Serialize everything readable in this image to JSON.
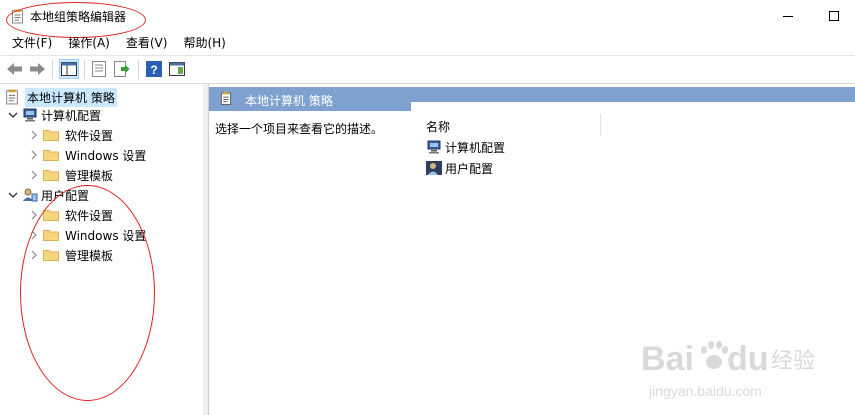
{
  "window": {
    "title": "本地组策略编辑器"
  },
  "menu": [
    {
      "label": "文件(F)"
    },
    {
      "label": "操作(A)"
    },
    {
      "label": "查看(V)"
    },
    {
      "label": "帮助(H)"
    }
  ],
  "toolbar": {
    "buttons": [
      "back-icon",
      "forward-icon",
      "show-hide-tree-icon",
      "properties-icon",
      "export-list-icon",
      "help-icon",
      "show-action-pane-icon"
    ]
  },
  "tree": {
    "root": "本地计算机 策略",
    "computer": {
      "label": "计算机配置",
      "children": [
        "软件设置",
        "Windows 设置",
        "管理模板"
      ]
    },
    "user": {
      "label": "用户配置",
      "children": [
        "软件设置",
        "Windows 设置",
        "管理模板"
      ]
    }
  },
  "right": {
    "header": "本地计算机 策略",
    "description": "选择一个项目来查看它的描述。",
    "column_name": "名称",
    "items": [
      "计算机配置",
      "用户配置"
    ]
  },
  "watermark": {
    "brand": "Bai du 经验",
    "url": "jingyan.baidu.com"
  },
  "colors": {
    "header_bar": "#7ea1cf",
    "selection": "#cce8ff",
    "annotation": "#dd2222",
    "folder": "#f5d67e"
  }
}
